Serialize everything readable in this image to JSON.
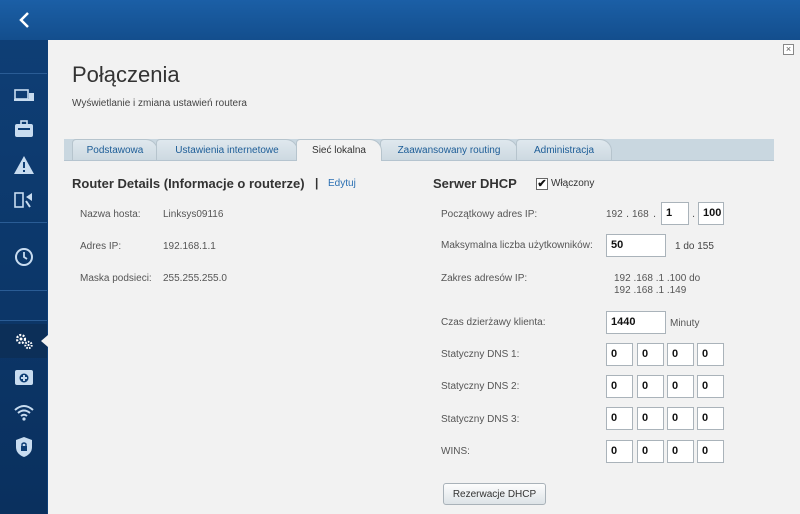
{
  "page": {
    "title": "Połączenia",
    "subtitle": "Wyświetlanie i zmiana ustawień routera",
    "close_glyph": "×"
  },
  "tabs": [
    {
      "label": "Podstawowa"
    },
    {
      "label": "Ustawienia internetowe"
    },
    {
      "label": "Sieć lokalna"
    },
    {
      "label": "Zaawansowany routing"
    },
    {
      "label": "Administracja"
    }
  ],
  "active_tab": "Sieć lokalna",
  "router_details": {
    "title": "Router Details (Informacje o routerze)",
    "separator": "|",
    "edit_label": "Edytuj",
    "host_label": "Nazwa hosta:",
    "host_value": "Linksys09116",
    "ip_label": "Adres IP:",
    "ip_value": "192.168.1.1",
    "mask_label": "Maska podsieci:",
    "mask_value": "255.255.255.0"
  },
  "dhcp": {
    "title": "Serwer DHCP",
    "enabled_label": "Włączony",
    "enabled": true,
    "check_glyph": "✔",
    "start_ip_label": "Początkowy adres IP:",
    "start_ip_prefix1": "192",
    "start_ip_prefix2": "168",
    "start_ip_octet3": "1",
    "start_ip_octet4": "100",
    "ip_dot": ".",
    "max_users_label": "Maksymalna liczba użytkowników:",
    "max_users_value": "50",
    "max_users_range": "1 do 155",
    "range_label": "Zakres adresów IP:",
    "range_start": "192 .168 .1 .100  do",
    "range_end": "192 .168 .1 .149",
    "lease_label": "Czas dzierżawy klienta:",
    "lease_value": "1440",
    "lease_unit": "Minuty",
    "dns1_label": "Statyczny DNS 1:",
    "dns1": [
      "0",
      "0",
      "0",
      "0"
    ],
    "dns2_label": "Statyczny DNS 2:",
    "dns2": [
      "0",
      "0",
      "0",
      "0"
    ],
    "dns3_label": "Statyczny DNS 3:",
    "dns3": [
      "0",
      "0",
      "0",
      "0"
    ],
    "wins_label": "WINS:",
    "wins": [
      "0",
      "0",
      "0",
      "0"
    ],
    "reservation_button": "Rezerwacje DHCP"
  },
  "sidebar": {
    "back_glyph": "<",
    "items": [
      {
        "name": "devices-icon"
      },
      {
        "name": "toolbox-icon"
      },
      {
        "name": "warning-icon"
      },
      {
        "name": "media-icon"
      },
      {
        "name": "clock-icon"
      },
      {
        "name": "settings-gears-icon"
      },
      {
        "name": "plus-medical-icon"
      },
      {
        "name": "wifi-icon"
      },
      {
        "name": "security-lock-icon"
      }
    ]
  },
  "colors": {
    "topbar": "#1b5fa6",
    "sidebar": "#0e3e75",
    "panel": "#f2f2f2",
    "tab_strip": "#c9d7e0",
    "link": "#2a6fb2"
  }
}
